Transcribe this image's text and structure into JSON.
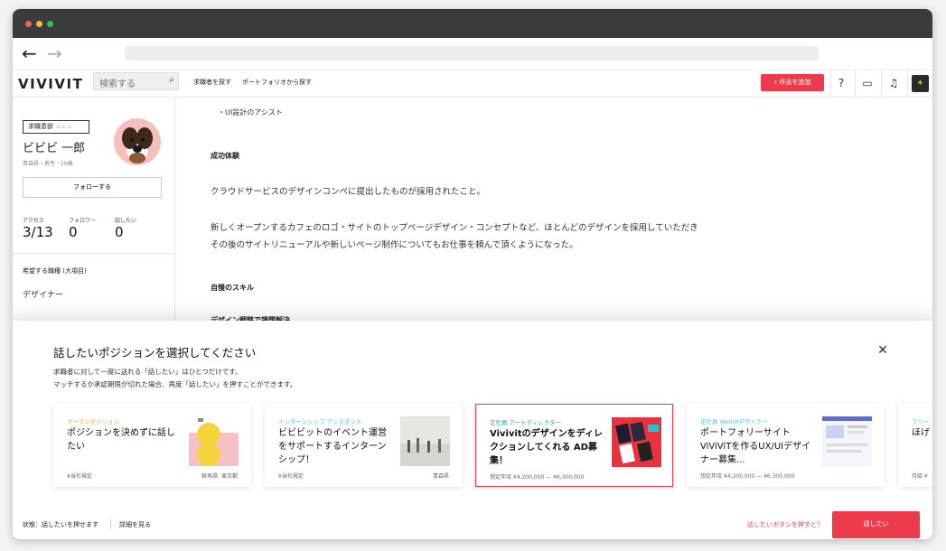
{
  "header": {
    "logo": "VIVIVIT",
    "search_placeholder": "検索する",
    "nav": [
      "求職者を探す",
      "ポートフォリオから探す"
    ],
    "add_work_label": "+ 作品を追加"
  },
  "sidebar": {
    "badge_label": "求職意欲",
    "name": "ビビビ 一郎",
    "meta": "青森県・男性・26歳",
    "follow_label": "フォローする",
    "stats": [
      {
        "label": "アクセス",
        "value": "3/13"
      },
      {
        "label": "フォロワー",
        "value": "0"
      },
      {
        "label": "話したい",
        "value": "0"
      }
    ],
    "job_heading": "希望する職種 (大項目)",
    "job_value": "デザイナー"
  },
  "main": {
    "line_top": "・UI設計のアシスト",
    "heading_success": "成功体験",
    "p1": "クラウドサービスのデザインコンペに提出したものが採用されたこと。",
    "p2a": "新しくオープンするカフェのロゴ・サイトのトップページデザイン・コンセプトなど、ほとんどのデザインを採用していただき",
    "p2b": "その後のサイトリニューアルや新しいページ制作についてもお仕事を頼んで頂くようになった。",
    "heading_skill": "自慢のスキル",
    "heading_strategy": "デザイン戦略で課題解決"
  },
  "modal": {
    "title": "話したいポジションを選択してください",
    "sub1": "求職者に対して一度に送れる「話したい」はひとつだけです。",
    "sub2": "マッチするか承認期限が切れた場合、再度「話したい」を押すことができます。",
    "cards": [
      {
        "tag": "オープンポジション",
        "tag_color": "#f5a623",
        "title": "ポジションを決めずに話したい",
        "foot": "¥当社規定",
        "loc": "群馬県, 東京都"
      },
      {
        "tag": "インターンシップ アシスタント",
        "tag_color": "#4fc1e9",
        "title": "ビビビットのイベント運営をサポートするインターンシップ！",
        "foot": "¥当社規定",
        "loc": "青森県"
      },
      {
        "tag": "正社員 アートディレクター",
        "tag_color": "#1fae8c",
        "title": "Vivivitのデザインをディレクションしてくれる AD募集！",
        "foot": "想定年収 ¥4,200,000 — ¥6,300,000",
        "loc": ""
      },
      {
        "tag": "正社員 WebUIデザイナー",
        "tag_color": "#4fc1e9",
        "title": "ポートフォリーサイトViViViTを作るUX/UIデザイナー募集...",
        "foot": "想定年収 ¥4,200,000 — ¥6,300,000",
        "loc": ""
      },
      {
        "tag": "フリー",
        "tag_color": "#4fc1e9",
        "title": "ほげ",
        "foot": "月給 ¥",
        "loc": ""
      }
    ],
    "status": "状態：話したいを押せます",
    "detail": "詳細を見る",
    "hint": "話したいボタンを押すと？",
    "talk_button": "話したい"
  },
  "colors": {
    "accent": "#ee3b4c"
  }
}
